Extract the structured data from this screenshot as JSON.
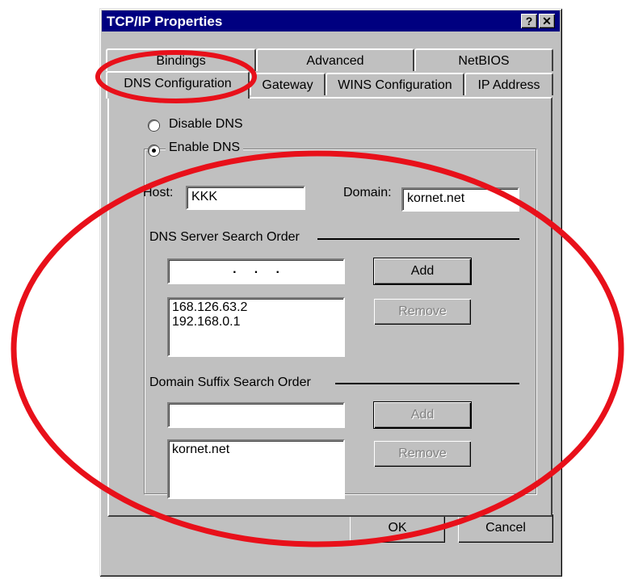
{
  "window": {
    "title": "TCP/IP Properties",
    "help_button": "?",
    "close_button": "✕"
  },
  "tabs": {
    "row_back": [
      "Bindings",
      "Advanced",
      "NetBIOS"
    ],
    "row_front": [
      "DNS Configuration",
      "Gateway",
      "WINS Configuration",
      "IP Address"
    ],
    "active": "DNS Configuration"
  },
  "dns": {
    "disable_label": "Disable DNS",
    "enable_label": "Enable DNS",
    "selected": "Enable DNS",
    "host_label": "Host:",
    "host_value": "KKK",
    "domain_label": "Domain:",
    "domain_value": "kornet.net",
    "server_order_label": "DNS Server Search Order",
    "server_ip_placeholder": ".     .     .",
    "server_add_label": "Add",
    "server_remove_label": "Remove",
    "servers": [
      "168.126.63.2",
      "192.168.0.1"
    ],
    "suffix_order_label": "Domain Suffix Search Order",
    "suffix_value": "",
    "suffix_add_label": "Add",
    "suffix_remove_label": "Remove",
    "suffixes": [
      "kornet.net"
    ]
  },
  "footer": {
    "ok_label": "OK",
    "cancel_label": "Cancel"
  },
  "annotation_color": "#e8101a"
}
